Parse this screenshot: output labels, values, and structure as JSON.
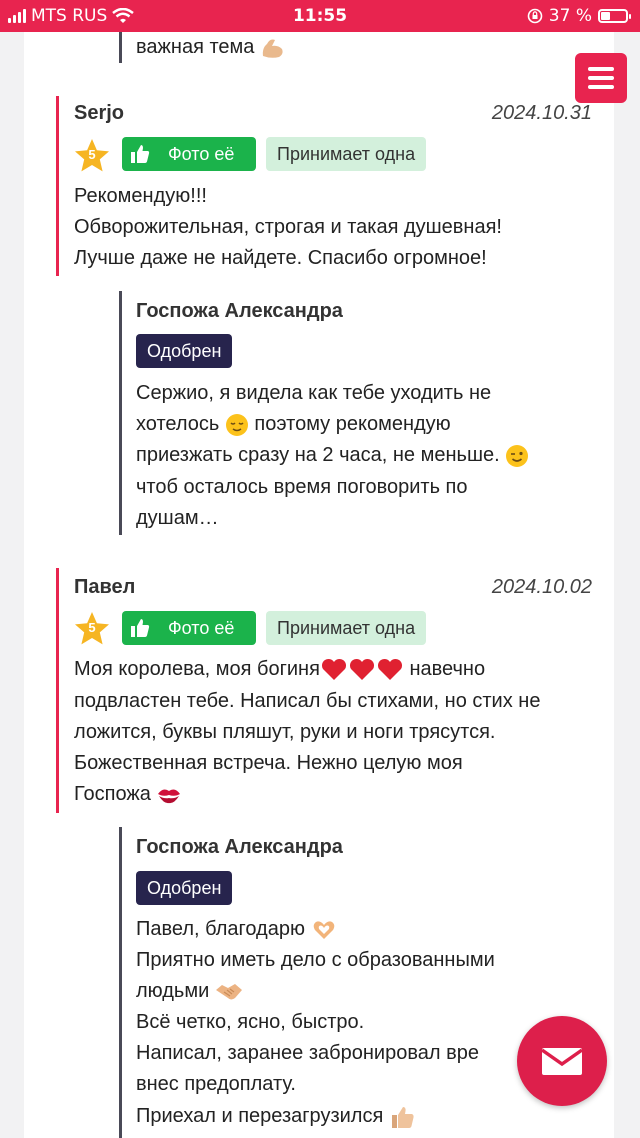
{
  "status_bar": {
    "carrier": "MTS RUS",
    "time": "11:55",
    "battery": "37 %",
    "battery_level": 0.37
  },
  "prev_review": {
    "tail_text": "важная тема"
  },
  "reviews": [
    {
      "author": "Serjo",
      "date": "2024.10.31",
      "rating": "5",
      "photo_button": "Фото её",
      "tag": "Принимает одна",
      "text_lines": [
        "Рекомендую!!!",
        "Обворожительная, строгая и такая душевная!",
        "Лучше даже не найдете. Спасибо огромное!"
      ],
      "reply": {
        "author": "Госпожа Александра",
        "status": "Одобрен",
        "text_lines": [
          "Сержио, я видела как тебе уходить не",
          "хотелось",
          "поэтому рекомендую",
          "приезжать сразу на 2 часа, не меньше.",
          "чтоб осталось время поговорить по",
          "душам…"
        ]
      }
    },
    {
      "author": "Павел",
      "date": "2024.10.02",
      "rating": "5",
      "photo_button": "Фото её",
      "tag": "Принимает одна",
      "text_lines": [
        "Моя королева, моя богиня",
        "навечно",
        "подвластен тебе. Написал бы стихами, но стих не",
        "ложится, буквы пляшут, руки и ноги трясутся.",
        "Божественная встреча. Нежно целую моя",
        "Госпожа"
      ],
      "reply": {
        "author": "Госпожа Александра",
        "status": "Одобрен",
        "text_lines": [
          "Павел, благодарю",
          "Приятно иметь дело с образованными",
          "людьми",
          "Всё четко, ясно, быстро.",
          "Написал, заранее забронировал вре",
          "внес предоплату.",
          "Приехал и перезагрузился"
        ]
      }
    }
  ],
  "colors": {
    "accent": "#e8244f",
    "photo_green": "#1bb34b",
    "tag_bg": "#d3f0dc",
    "badge_bg": "#27244d",
    "star": "#f6b523"
  },
  "icons": {
    "menu": "hamburger-icon",
    "mail": "envelope-icon",
    "star": "star-icon",
    "thumb": "thumbs-up-icon"
  }
}
